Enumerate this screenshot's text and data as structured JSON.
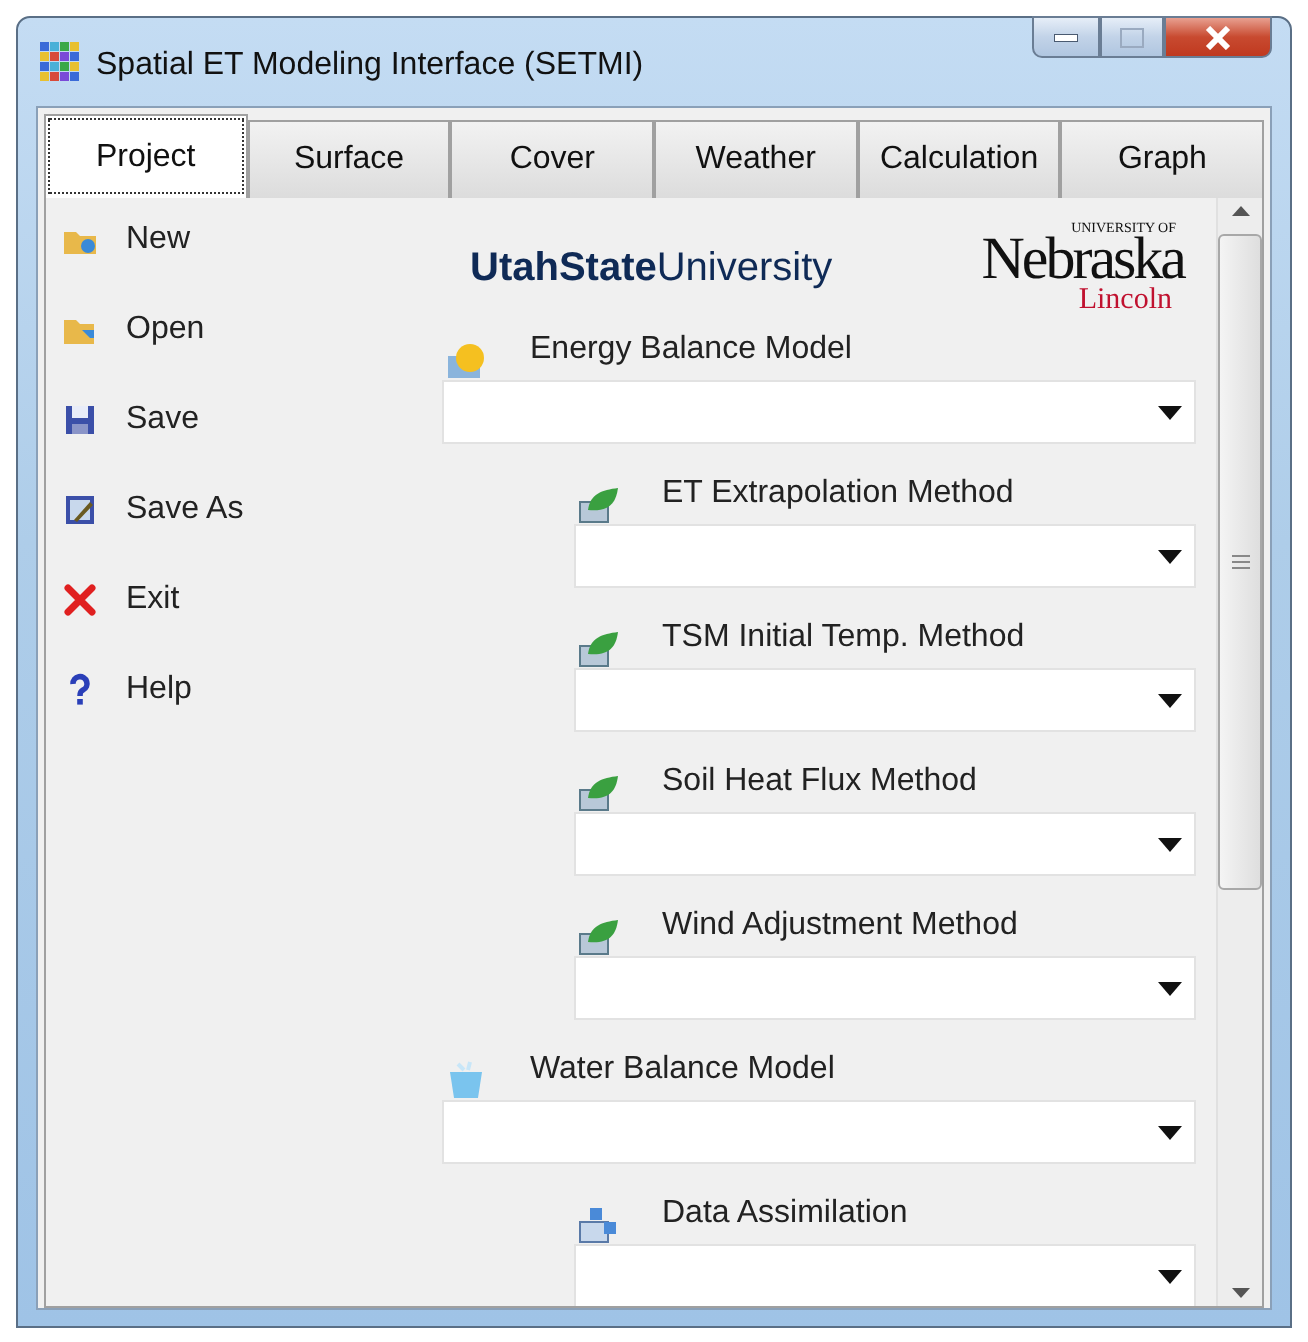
{
  "window": {
    "title": "Spatial ET Modeling Interface (SETMI)"
  },
  "tabs": [
    {
      "label": "Project",
      "selected": true
    },
    {
      "label": "Surface",
      "selected": false
    },
    {
      "label": "Cover",
      "selected": false
    },
    {
      "label": "Weather",
      "selected": false
    },
    {
      "label": "Calculation",
      "selected": false
    },
    {
      "label": "Graph",
      "selected": false
    }
  ],
  "sidebar": {
    "items": [
      {
        "label": "New",
        "kind": "new"
      },
      {
        "label": "Open",
        "kind": "open"
      },
      {
        "label": "Save",
        "kind": "save"
      },
      {
        "label": "Save As",
        "kind": "saveas"
      },
      {
        "label": "Exit",
        "kind": "exit"
      },
      {
        "label": "Help",
        "kind": "help"
      }
    ]
  },
  "logos": {
    "usu": "**UtahState**University",
    "unl_top": "UNIVERSITY OF",
    "unl_name": "Nebraska",
    "unl_sub": "Lincoln"
  },
  "models": [
    {
      "label": "Energy Balance Model",
      "kind": "energy",
      "children": [
        {
          "label": "ET Extrapolation Method",
          "kind": "method"
        },
        {
          "label": "TSM Initial Temp. Method",
          "kind": "method"
        },
        {
          "label": "Soil Heat Flux Method",
          "kind": "method"
        },
        {
          "label": "Wind Adjustment Method",
          "kind": "method"
        }
      ]
    },
    {
      "label": "Water Balance Model",
      "kind": "water",
      "children": [
        {
          "label": "Data Assimilation",
          "kind": "assimilation"
        }
      ]
    }
  ]
}
